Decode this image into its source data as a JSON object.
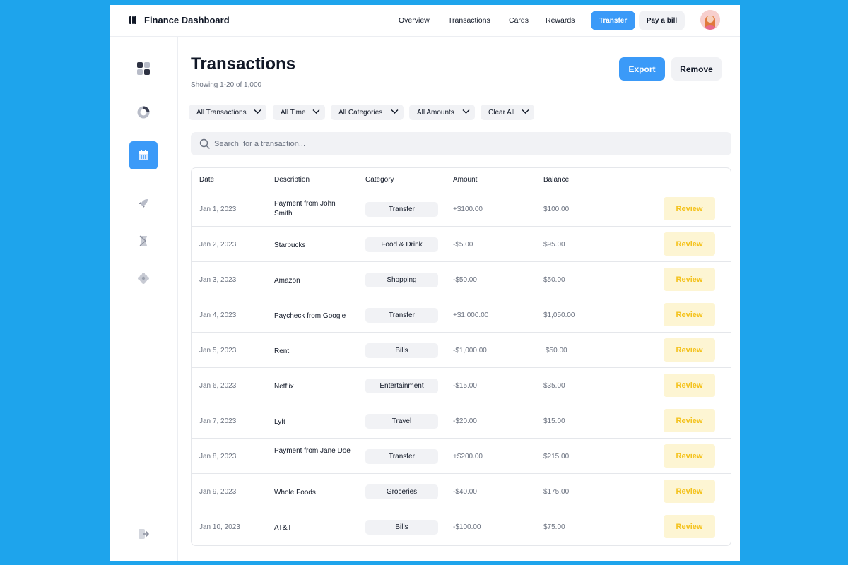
{
  "app": {
    "title": "Finance Dashboard"
  },
  "nav": {
    "links": [
      "Overview",
      "Transactions",
      "Cards",
      "Rewards"
    ],
    "transfer_label": "Transfer",
    "pay_bill_label": "Pay a bill"
  },
  "sidebar": {
    "items": [
      {
        "icon": "dashboard-grid-icon",
        "active": false
      },
      {
        "icon": "analytics-ring-icon",
        "active": false
      },
      {
        "icon": "calendar-icon",
        "active": true
      },
      {
        "icon": "rocket-icon",
        "active": false
      },
      {
        "icon": "receipt-icon",
        "active": false
      },
      {
        "icon": "settings-icon",
        "active": false
      }
    ],
    "logout_icon": "logout-icon"
  },
  "main": {
    "title": "Transactions",
    "subtitle": "Showing 1-20 of 1,000",
    "export_label": "Export",
    "remove_label": "Remove",
    "filters": [
      "All Transactions",
      "All Time",
      "All Categories",
      "All Amounts",
      "Clear All"
    ],
    "search_placeholder": "Search  for a transaction..."
  },
  "table": {
    "columns": [
      "Date",
      "Description",
      "Category",
      "Amount",
      "Balance"
    ],
    "review_label": "Review",
    "rows": [
      {
        "date": "Jan 1, 2023",
        "description": "Payment from John Smith",
        "category": "Transfer",
        "amount": "+$100.00",
        "balance": "$100.00"
      },
      {
        "date": "Jan 2, 2023",
        "description": "Starbucks",
        "category": "Food & Drink",
        "amount": "-$5.00",
        "balance": "$95.00"
      },
      {
        "date": "Jan 3, 2023",
        "description": "Amazon",
        "category": "Shopping",
        "amount": "-$50.00",
        "balance": "$50.00"
      },
      {
        "date": "Jan 4, 2023",
        "description": "Paycheck from Google",
        "category": "Transfer",
        "amount": "+$1,000.00",
        "balance": "$1,050.00"
      },
      {
        "date": "Jan 5, 2023",
        "description": "Rent",
        "category": "Bills",
        "amount": "-$1,000.00",
        "balance": "$50.00"
      },
      {
        "date": "Jan 6, 2023",
        "description": "Netflix",
        "category": "Entertainment",
        "amount": "-$15.00",
        "balance": "$35.00"
      },
      {
        "date": "Jan 7, 2023",
        "description": "Lyft",
        "category": "Travel",
        "amount": "-$20.00",
        "balance": "$15.00"
      },
      {
        "date": "Jan 8, 2023",
        "description": "Payment from Jane Doe",
        "category": "Transfer",
        "amount": "+$200.00",
        "balance": "$215.00"
      },
      {
        "date": "Jan 9, 2023",
        "description": "Whole Foods",
        "category": "Groceries",
        "amount": "-$40.00",
        "balance": "$175.00"
      },
      {
        "date": "Jan 10, 2023",
        "description": "AT&T",
        "category": "Bills",
        "amount": "-$100.00",
        "balance": "$75.00"
      }
    ]
  },
  "colors": {
    "background": "#1ea4ec",
    "accent": "#3b9af8",
    "review_bg": "#fdf5d3",
    "review_text": "#f4c21b"
  }
}
